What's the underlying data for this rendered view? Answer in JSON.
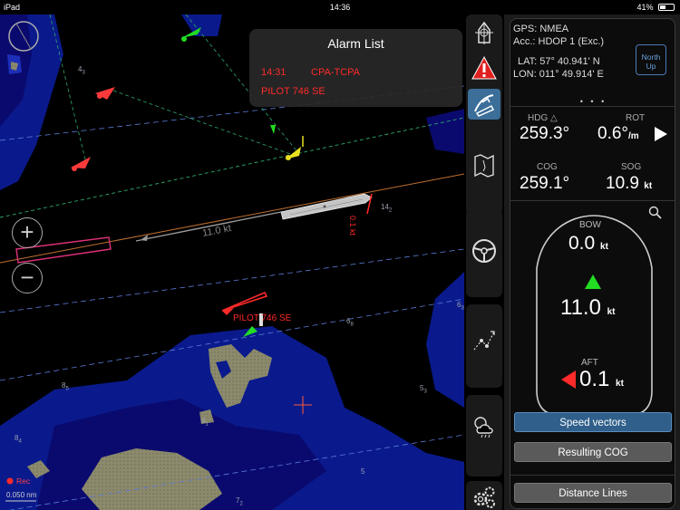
{
  "status": {
    "device": "iPad",
    "time": "14:36",
    "battery": "41%",
    "battery_level": 0.41
  },
  "map": {
    "depths": [
      {
        "v": "4",
        "s": "3"
      },
      {
        "v": "14",
        "s": "2"
      },
      {
        "v": "6",
        "s": "3"
      },
      {
        "v": "6",
        "s": "8"
      },
      {
        "v": "8",
        "s": "5"
      },
      {
        "v": "5",
        "s": "3"
      },
      {
        "v": "4",
        "s": "1"
      },
      {
        "v": "8",
        "s": "4"
      },
      {
        "v": "5",
        "s": ""
      },
      {
        "v": "7",
        "s": "2"
      }
    ],
    "own_speed": "11.0 kt",
    "target_speed": "0.1 kt",
    "target_label": "PILOT 746 SE",
    "rec_label": "Rec",
    "scale_label": "0.050 nm"
  },
  "alarm": {
    "title": "Alarm List",
    "time": "14:31",
    "type": "CPA-TCPA",
    "target": "PILOT 746 SE"
  },
  "toolbar": {
    "items": [
      "ship-icon",
      "alarm-icon",
      "pilot-icon",
      "chart-icon",
      "steering-wheel-icon",
      "route-icon",
      "weather-icon",
      "settings-icon"
    ],
    "selected": "pilot-icon"
  },
  "panel": {
    "gps_label": "GPS:",
    "gps_value": "NMEA",
    "acc_label": "Acc.:",
    "acc_value": "HDOP 1 (Exc.)",
    "lat_label": "LAT:",
    "lat_value": "57° 40.941' N",
    "lon_label": "LON:",
    "lon_value": "011° 49.914' E",
    "north_up_1": "North",
    "north_up_2": "Up",
    "page_dots": "• • •",
    "hdg_label": "HDG",
    "hdg_value": "259.3°",
    "rot_label": "ROT",
    "rot_value": "0.6°",
    "rot_unit": "/m",
    "cog_label": "COG",
    "cog_value": "259.1°",
    "sog_label": "SOG",
    "sog_value": "10.9",
    "sog_unit": "kt",
    "bow_label": "BOW",
    "bow_value": "0.0",
    "bow_unit": "kt",
    "fwd_value": "11.0",
    "fwd_unit": "kt",
    "aft_label": "AFT",
    "aft_value": "0.1",
    "aft_unit": "kt",
    "btn_speed_vectors": "Speed vectors",
    "btn_resulting_cog": "Resulting COG",
    "btn_distance_lines": "Distance Lines"
  },
  "colors": {
    "accent": "#2f5f8a",
    "alarm": "#ff2a2a",
    "green": "#22dd22",
    "land": "#8a8a6a",
    "water": "#0a1a8c"
  }
}
